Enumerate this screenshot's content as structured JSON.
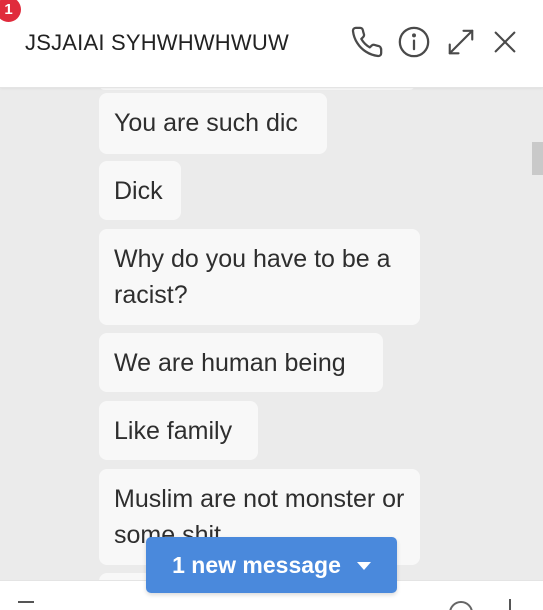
{
  "header": {
    "badge_count": "1",
    "contact_name": "JSJAIAI SYHWHWHWUW",
    "icons": [
      "phone-icon",
      "info-icon",
      "expand-icon",
      "close-icon"
    ]
  },
  "messages": [
    {
      "text": "You are such dic"
    },
    {
      "text": "Dick"
    },
    {
      "text": "Why do you have to be a racist?"
    },
    {
      "text": "We are human being"
    },
    {
      "text": "Like family"
    },
    {
      "text": "Muslim are not monster or some shit"
    }
  ],
  "new_message_button": {
    "label": "1 new message"
  },
  "colors": {
    "accent": "#4a89dc",
    "badge": "#e02b3c",
    "bubble": "#f8f8f8",
    "background": "#ebebeb"
  }
}
